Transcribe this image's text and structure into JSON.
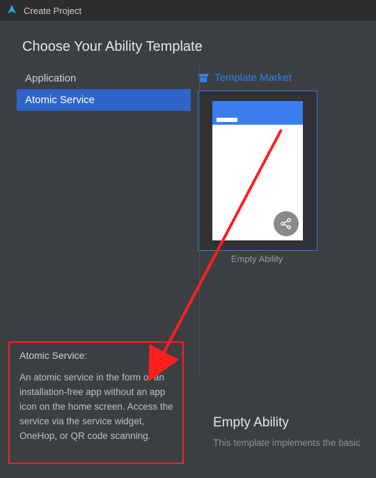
{
  "window": {
    "title": "Create Project"
  },
  "heading": "Choose Your Ability Template",
  "categories": [
    {
      "label": "Application"
    },
    {
      "label": "Atomic Service"
    }
  ],
  "marketLink": "Template Market",
  "template": {
    "name": "Empty Ability"
  },
  "description": {
    "title": "Atomic Service:",
    "body": "An atomic service in the form of an installation-free app without an app icon on the home screen. Access the service via the service widget, OneHop, or QR code scanning."
  },
  "detail": {
    "title": "Empty Ability",
    "subtitle": "This template implements the basic"
  }
}
